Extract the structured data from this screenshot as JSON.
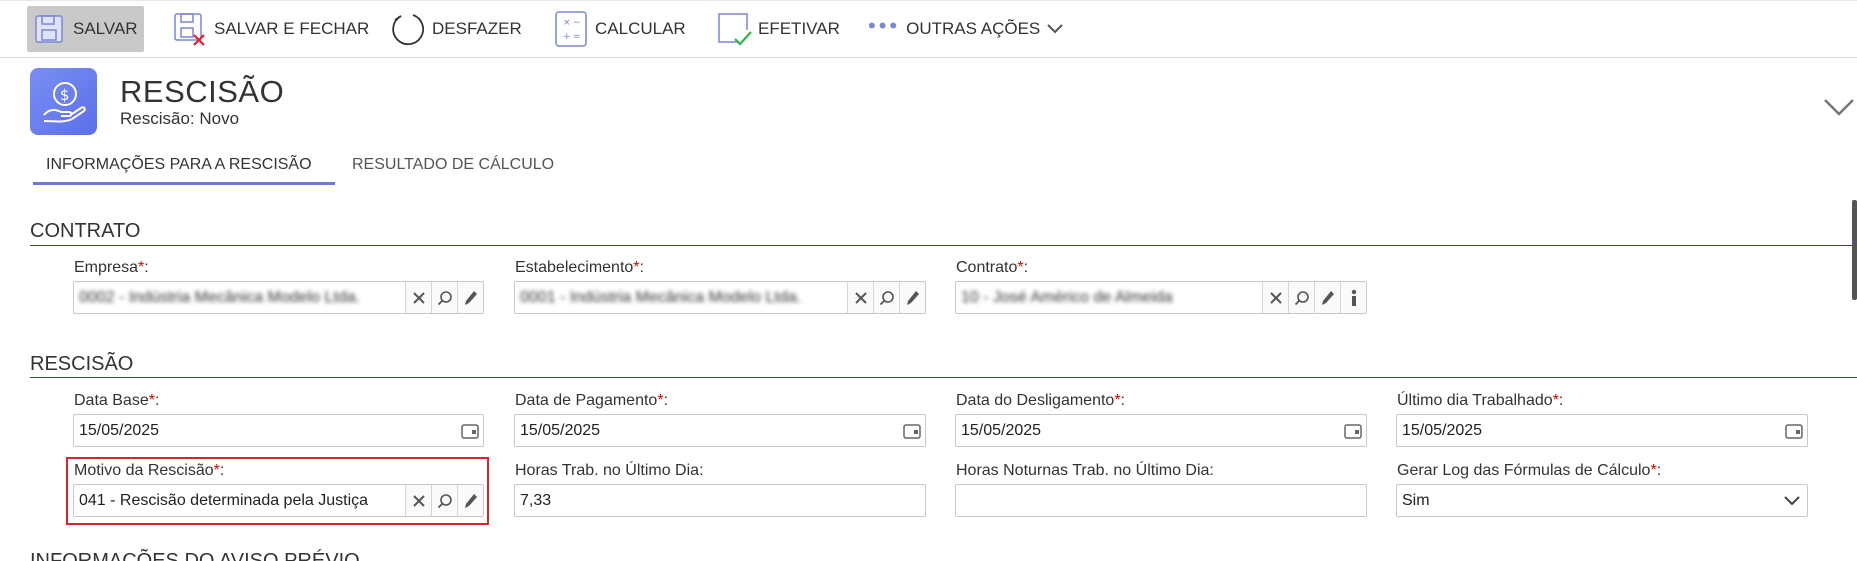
{
  "toolbar": {
    "save": "SALVAR",
    "save_close": "SALVAR E FECHAR",
    "undo": "DESFAZER",
    "calculate": "CALCULAR",
    "effectuate": "EFETIVAR",
    "more_actions": "OUTRAS AÇÕES"
  },
  "header": {
    "title": "RESCISÃO",
    "subtitle": "Rescisão: Novo",
    "icon": "money-hand-icon",
    "icon_color": "#6a7ef0"
  },
  "tabs": [
    {
      "label": "INFORMAÇÕES PARA A RESCISÃO",
      "active": true
    },
    {
      "label": "RESULTADO DE CÁLCULO",
      "active": false
    }
  ],
  "contrato": {
    "title": "CONTRATO",
    "empresa": {
      "label": "Empresa",
      "required": "*",
      "suffix": ":",
      "value": "0002 - Indústria Mecânica Modelo Ltda."
    },
    "estabelecimento": {
      "label": "Estabelecimento",
      "required": "*",
      "suffix": ":",
      "value": "0001 - Indústria Mecânica Modelo Ltda."
    },
    "contrato": {
      "label": "Contrato",
      "required": "*",
      "suffix": ":",
      "value": "10 - José Américo de Almeida"
    }
  },
  "rescisao": {
    "title": "RESCISÃO",
    "data_base": {
      "label": "Data Base",
      "required": "*",
      "suffix": ":",
      "value": "15/05/2025"
    },
    "data_pagamento": {
      "label": "Data de Pagamento",
      "required": "*",
      "suffix": ":",
      "value": "15/05/2025"
    },
    "data_desligamento": {
      "label": "Data do Desligamento",
      "required": "*",
      "suffix": ":",
      "value": "15/05/2025"
    },
    "ultimo_dia": {
      "label": "Último dia Trabalhado",
      "required": "*",
      "suffix": ":",
      "value": "15/05/2025"
    },
    "motivo": {
      "label": "Motivo da Rescisão",
      "required": "*",
      "suffix": ":",
      "value": "041 - Rescisão determinada pela Justiça"
    },
    "horas_trab": {
      "label": "Horas Trab. no Último Dia:",
      "value": "7,33"
    },
    "horas_noturnas": {
      "label": "Horas Noturnas Trab. no Último Dia:",
      "value": ""
    },
    "gerar_log": {
      "label": "Gerar Log das Fórmulas de Cálculo",
      "required": "*",
      "suffix": ":",
      "value": "Sim"
    }
  },
  "next_section": {
    "title": "INFORMAÇÕES DO AVISO PRÉVIO"
  },
  "colors": {
    "accent": "#6e78d8",
    "required": "#e00000",
    "highlight": "#d9252a"
  }
}
